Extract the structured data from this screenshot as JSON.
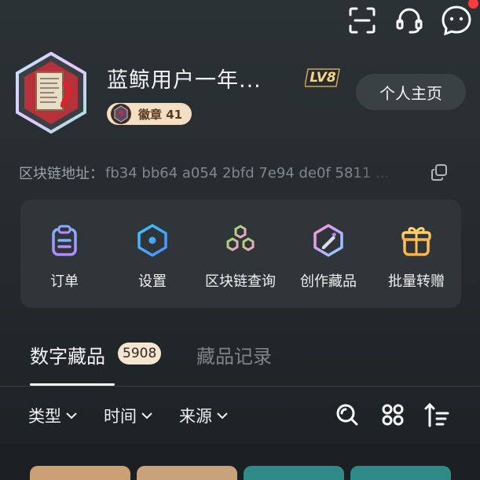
{
  "topbar": {
    "icons": [
      "scan-icon",
      "headset-icon",
      "chat-bot-icon"
    ],
    "has_notification": true
  },
  "profile": {
    "name": "蓝鲸用户一年...",
    "level": "LV8",
    "home_button": "个人主页",
    "badge_label": "徽章 41"
  },
  "address": {
    "label": "区块链地址：",
    "value": "fb34 bb64 a054 2bfd 7e94 de0f 5811 ..."
  },
  "menu": {
    "items": [
      {
        "label": "订单",
        "icon": "clipboard-icon"
      },
      {
        "label": "设置",
        "icon": "settings-hex-icon"
      },
      {
        "label": "区块链查询",
        "icon": "blockchain-icon"
      },
      {
        "label": "创作藏品",
        "icon": "create-icon"
      },
      {
        "label": "批量转赠",
        "icon": "gift-icon"
      }
    ]
  },
  "tabs": {
    "active": "数字藏品",
    "count": "5908",
    "other": "藏品记录"
  },
  "filters": {
    "type": "类型",
    "time": "时间",
    "source": "来源"
  },
  "colors": {
    "accent_gold": "#f4dfc4",
    "background": "#262c2f",
    "panel": "#2f3538",
    "notification": "#ff3b3b"
  }
}
